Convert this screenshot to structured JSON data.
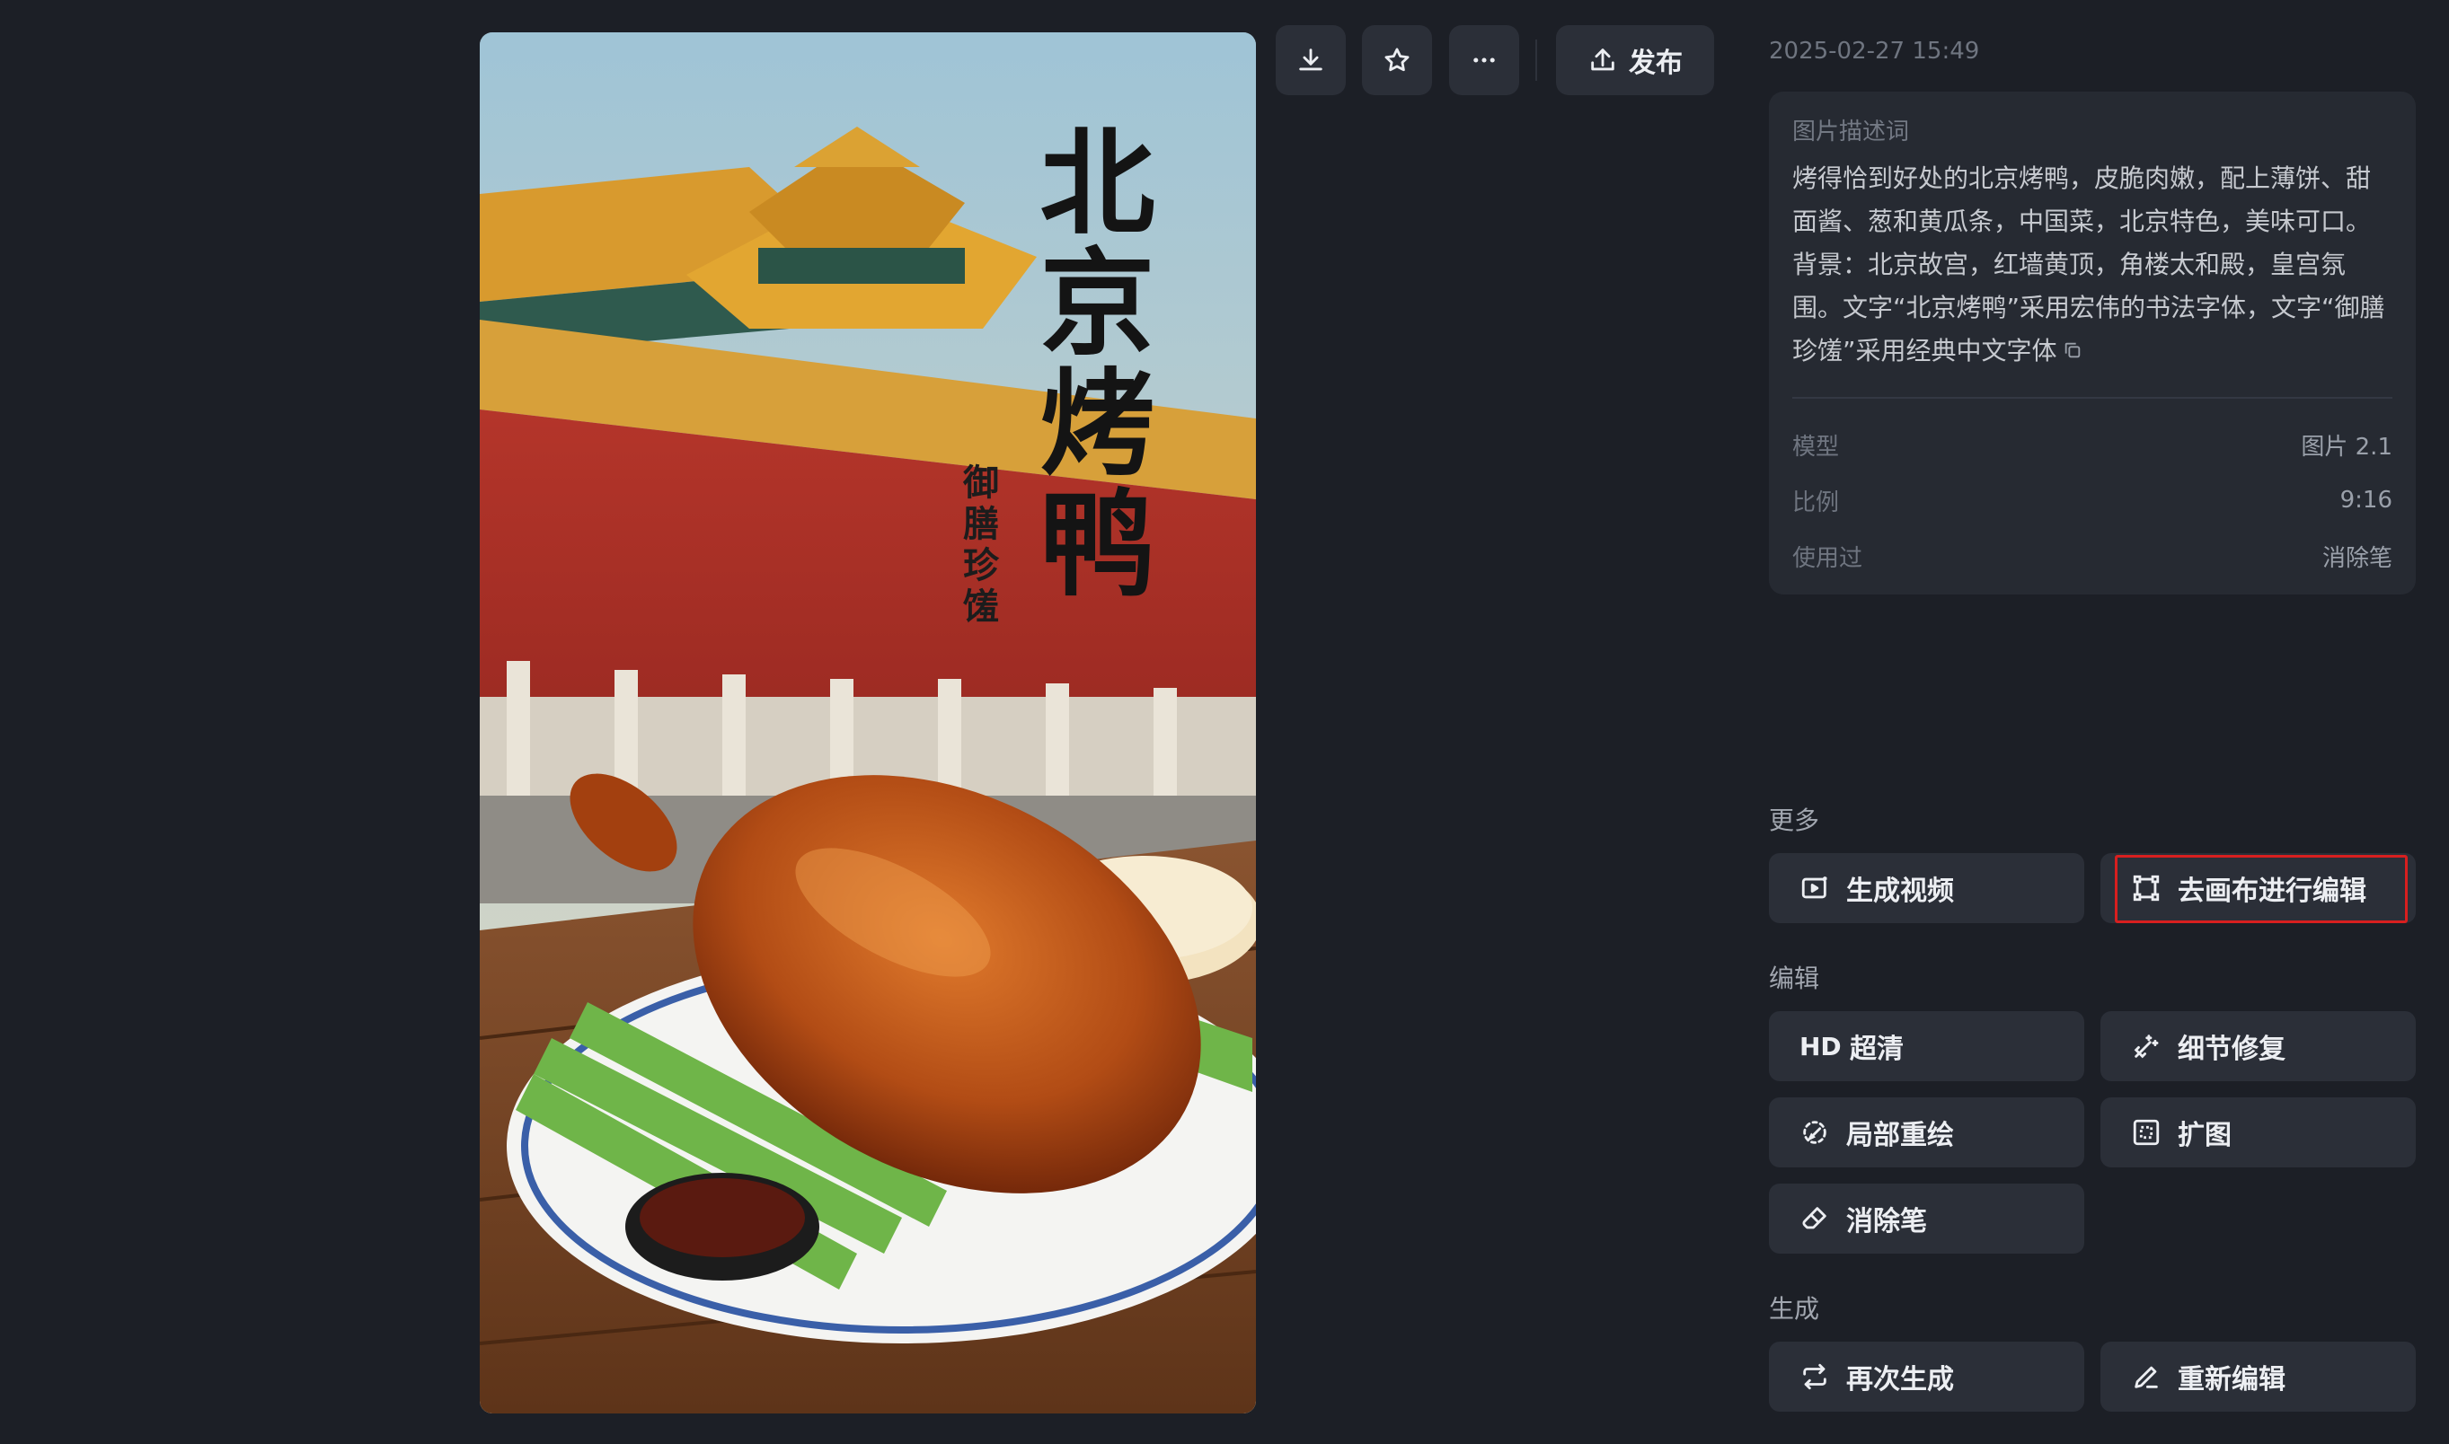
{
  "poster": {
    "title": "北京烤鸭",
    "subtitle": "御膳珍馐"
  },
  "toolbar": {
    "download_icon": "download-icon",
    "star_icon": "star-icon",
    "more_icon": "more-horizontal-icon",
    "publish_label": "发布"
  },
  "panel": {
    "timestamp": "2025-02-27 15:49",
    "prompt_label": "图片描述词",
    "prompt_text": "烤得恰到好处的北京烤鸭，皮脆肉嫩，配上薄饼、甜面酱、葱和黄瓜条，中国菜，北京特色，美味可口。背景：北京故宫，红墙黄顶，角楼太和殿，皇宫氛围。文字“北京烤鸭”采用宏伟的书法字体，文字“御膳珍馐”采用经典中文字体",
    "meta": [
      {
        "key": "模型",
        "value": "图片 2.1"
      },
      {
        "key": "比例",
        "value": "9:16"
      },
      {
        "key": "使用过",
        "value": "消除笔"
      }
    ]
  },
  "sections": {
    "more": {
      "title": "更多",
      "buttons": [
        {
          "label": "生成视频",
          "icon": "video-generate-icon"
        },
        {
          "label": "去画布进行编辑",
          "icon": "canvas-edit-icon"
        }
      ]
    },
    "edit": {
      "title": "编辑",
      "buttons": [
        {
          "label": "超清",
          "icon": "HD"
        },
        {
          "label": "细节修复",
          "icon": "magic-wand-icon"
        },
        {
          "label": "局部重绘",
          "icon": "partial-repaint-icon"
        },
        {
          "label": "扩图",
          "icon": "expand-image-icon"
        },
        {
          "label": "消除笔",
          "icon": "eraser-icon"
        }
      ]
    },
    "generate": {
      "title": "生成",
      "buttons": [
        {
          "label": "再次生成",
          "icon": "regenerate-icon"
        },
        {
          "label": "重新编辑",
          "icon": "pencil-icon"
        }
      ]
    }
  },
  "colors": {
    "background": "#1c1f26",
    "button": "#2b2f38",
    "card": "#262a32",
    "highlight": "#d81f1f"
  }
}
